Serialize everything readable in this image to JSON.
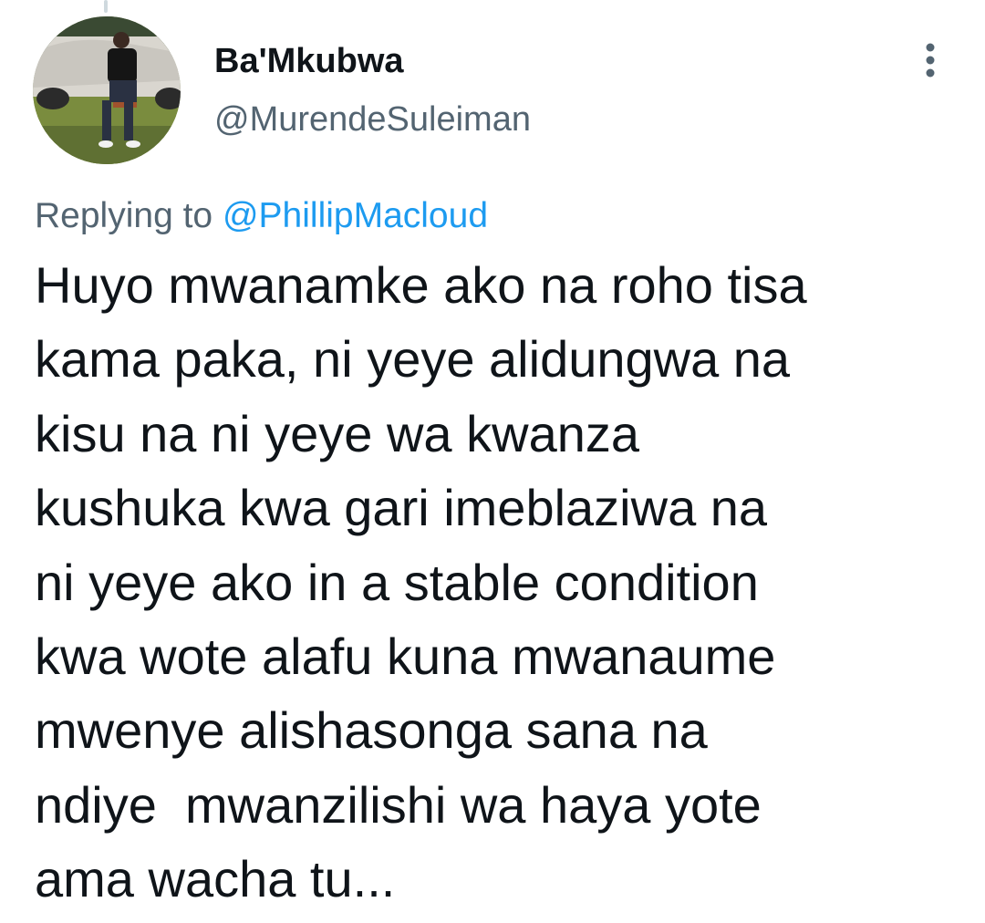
{
  "author": {
    "display_name": "Ba'Mkubwa",
    "handle": "@MurendeSuleiman"
  },
  "reply_context": {
    "prefix": "Replying to ",
    "handle": "@PhillipMacloud"
  },
  "tweet": {
    "lines": [
      "Huyo mwanamke ako na roho tisa",
      "kama paka, ni yeye alidungwa na",
      "kisu na ni yeye wa kwanza",
      "kushuka kwa gari imeblaziwa na",
      "ni yeye ako in a stable condition",
      "kwa wote alafu kuna mwanaume",
      "mwenye alishasonga sana na",
      "ndiye  mwanzilishi wa haya yote",
      "ama wacha tu..."
    ]
  },
  "icons": {
    "more": "more-vertical-icon"
  },
  "colors": {
    "text_primary": "#0f1419",
    "text_secondary": "#536471",
    "link": "#1d9bf0",
    "background": "#ffffff"
  }
}
